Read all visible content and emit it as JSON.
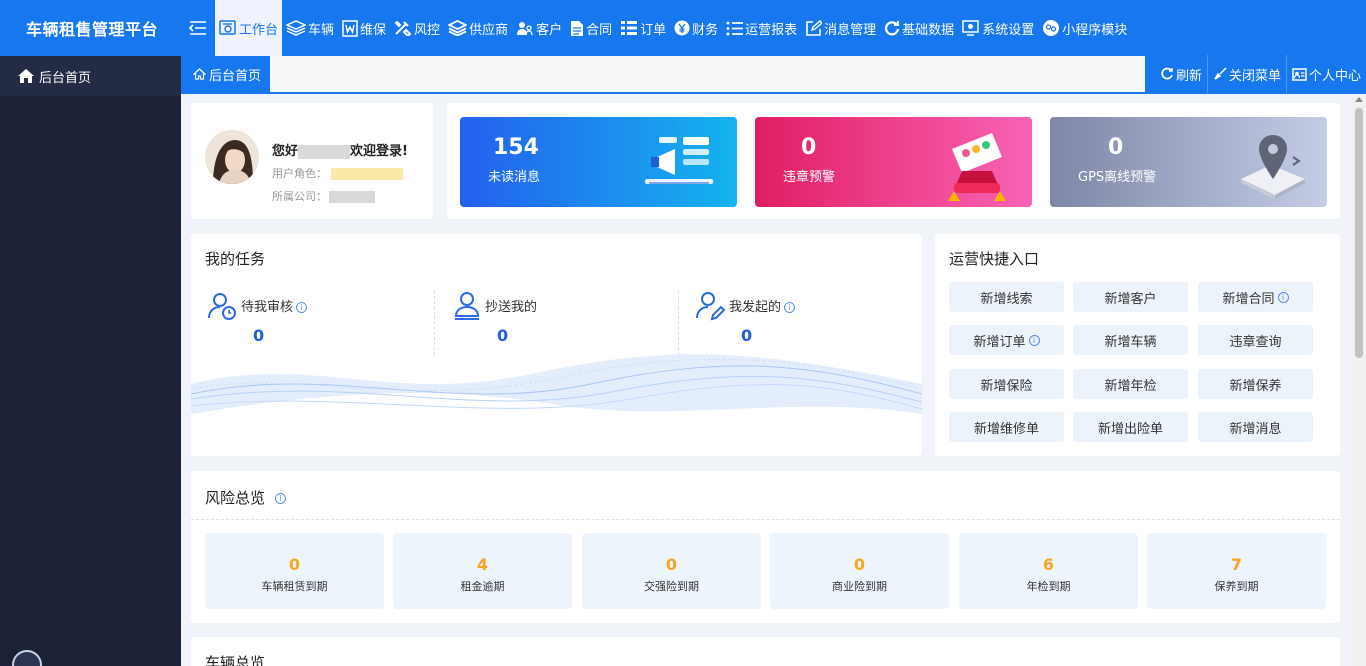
{
  "app": {
    "title": "车辆租售管理平台"
  },
  "nav": {
    "items": [
      {
        "label": "工作台",
        "icon": "dashboard-icon",
        "active": true
      },
      {
        "label": "车辆",
        "icon": "layers-icon"
      },
      {
        "label": "维保",
        "icon": "word-doc-icon"
      },
      {
        "label": "风控",
        "icon": "tools-icon"
      },
      {
        "label": "供应商",
        "icon": "stack-icon"
      },
      {
        "label": "客户",
        "icon": "users-icon"
      },
      {
        "label": "合同",
        "icon": "file-icon"
      },
      {
        "label": "订单",
        "icon": "list-icon"
      },
      {
        "label": "财务",
        "icon": "yen-icon"
      },
      {
        "label": "运营报表",
        "icon": "bullet-list-icon"
      },
      {
        "label": "消息管理",
        "icon": "edit-icon"
      },
      {
        "label": "基础数据",
        "icon": "refresh-icon"
      },
      {
        "label": "系统设置",
        "icon": "settings-icon"
      },
      {
        "label": "小程序模块",
        "icon": "wechat-icon"
      }
    ]
  },
  "sidebar": {
    "items": [
      {
        "label": "后台首页",
        "icon": "home-icon"
      }
    ]
  },
  "tabs": {
    "items": [
      {
        "label": "后台首页",
        "icon": "home-icon"
      }
    ],
    "actions": {
      "refresh": "刷新",
      "close_menu": "关闭菜单",
      "profile": "个人中心"
    }
  },
  "user": {
    "greeting_prefix": "您好",
    "greeting_suffix": "欢迎登录!",
    "role_label": "用户角色：",
    "company_label": "所属公司："
  },
  "stats": [
    {
      "value": "154",
      "label": "未读消息"
    },
    {
      "value": "0",
      "label": "违章预警"
    },
    {
      "value": "0",
      "label": "GPS离线预警"
    }
  ],
  "tasks": {
    "title": "我的任务",
    "items": [
      {
        "label": "待我审核",
        "value": "0",
        "info": true
      },
      {
        "label": "抄送我的",
        "value": "0",
        "info": false
      },
      {
        "label": "我发起的",
        "value": "0",
        "info": true
      }
    ]
  },
  "quick": {
    "title": "运营快捷入口",
    "buttons": [
      {
        "label": "新增线索",
        "info": false
      },
      {
        "label": "新增客户",
        "info": false
      },
      {
        "label": "新增合同",
        "info": true
      },
      {
        "label": "新增订单",
        "info": true
      },
      {
        "label": "新增车辆",
        "info": false
      },
      {
        "label": "违章查询",
        "info": false
      },
      {
        "label": "新增保险",
        "info": false
      },
      {
        "label": "新增年检",
        "info": false
      },
      {
        "label": "新增保养",
        "info": false
      },
      {
        "label": "新增维修单",
        "info": false
      },
      {
        "label": "新增出险单",
        "info": false
      },
      {
        "label": "新增消息",
        "info": false
      }
    ]
  },
  "risk": {
    "title": "风险总览",
    "items": [
      {
        "value": "0",
        "label": "车辆租赁到期"
      },
      {
        "value": "4",
        "label": "租金逾期"
      },
      {
        "value": "0",
        "label": "交强险到期"
      },
      {
        "value": "0",
        "label": "商业险到期"
      },
      {
        "value": "6",
        "label": "年检到期"
      },
      {
        "value": "7",
        "label": "保养到期"
      }
    ]
  },
  "vehicle": {
    "title": "车辆总览"
  },
  "colors": {
    "primary": "#1677ee",
    "sidebar": "#1b2136",
    "risk_value": "#f5a623",
    "task_value": "#1f5fd6"
  }
}
